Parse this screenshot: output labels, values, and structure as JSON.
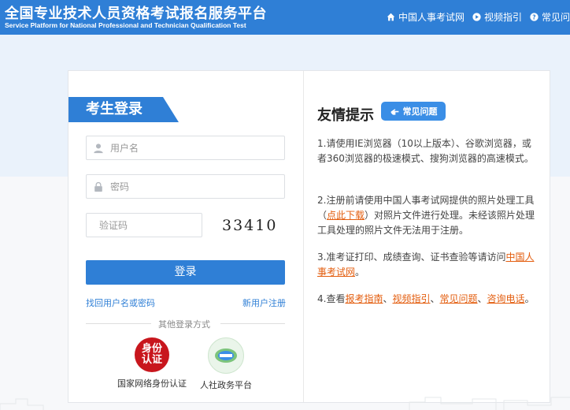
{
  "header": {
    "title": "全国专业技术人员资格考试报名服务平台",
    "subtitle": "Service Platform for National Professional and Technician Qualification Test",
    "nav": [
      {
        "icon": "home-icon",
        "label": "中国人事考试网"
      },
      {
        "icon": "play-icon",
        "label": "视频指引"
      },
      {
        "icon": "question-icon",
        "label": "常见问"
      }
    ]
  },
  "login": {
    "tab_label": "考生登录",
    "username_placeholder": "用户名",
    "password_placeholder": "密码",
    "captcha_placeholder": "验证码",
    "captcha_text": "33410",
    "submit_label": "登录",
    "forgot_link": "找回用户名或密码",
    "register_link": "新用户注册",
    "other_methods_label": "其他登录方式",
    "alt_methods": [
      {
        "badge": "身份认证",
        "label": "国家网络身份认证"
      },
      {
        "label": "人社政务平台"
      }
    ]
  },
  "tips": {
    "title": "友情提示",
    "faq_label": "常见问题",
    "item1": "1.请使用IE浏览器（10以上版本）、谷歌浏览器，或者360浏览器的极速模式、搜狗浏览器的高速模式。",
    "item2_a": "2.注册前请使用中国人事考试网提供的照片处理工具（",
    "item2_link": "点此下载",
    "item2_b": "）对照片文件进行处理。未经该照片处理工具处理的照片文件无法用于注册。",
    "item3_a": "3.准考证打印、成绩查询、证书查验等请访问",
    "item3_link": "中国人事考试网",
    "item3_b": "。",
    "item4_a": "4.查看",
    "item4_links": [
      "报考指南",
      "视频指引",
      "常见问题",
      "咨询电话"
    ],
    "item4_sep": "、",
    "item4_end": "。"
  },
  "colors": {
    "primary": "#2f7fd6",
    "link_orange": "#e35d0e"
  }
}
